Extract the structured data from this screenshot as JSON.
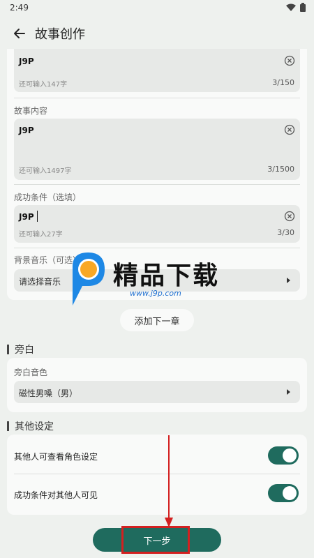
{
  "status_bar": {
    "time": "2:49"
  },
  "header": {
    "title": "故事创作"
  },
  "chapter_card": {
    "title_field": {
      "value": "J9P",
      "hint": "还可输入147字",
      "counter": "3/150"
    },
    "content_field": {
      "label": "故事内容",
      "value": "J9P",
      "hint": "还可输入1497字",
      "counter": "3/1500"
    },
    "success_field": {
      "label": "成功条件（选填）",
      "value": "J9P",
      "hint": "还可输入27字",
      "counter": "3/30"
    },
    "music_field": {
      "label": "背景音乐（可选）",
      "placeholder": "请选择音乐"
    }
  },
  "add_chapter_label": "添加下一章",
  "narration": {
    "section_title": "旁白",
    "voice_label": "旁白音色",
    "voice_value": "磁性男嗓（男）"
  },
  "other_settings": {
    "section_title": "其他设定",
    "items": [
      {
        "label": "其他人可查看角色设定",
        "enabled": true
      },
      {
        "label": "成功条件对其他人可见",
        "enabled": true
      }
    ]
  },
  "next_button_label": "下一步",
  "watermark": {
    "brand": "精品下载",
    "url": "www.j9p.com"
  },
  "colors": {
    "accent": "#1f6b5e",
    "background": "#eef1ee",
    "annotation": "#d32020"
  }
}
